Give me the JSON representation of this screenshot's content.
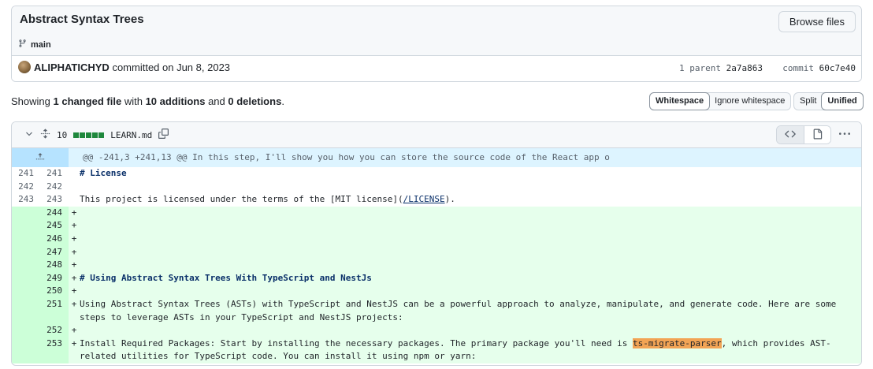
{
  "commit": {
    "title": "Abstract Syntax Trees",
    "browse_label": "Browse files",
    "branch": "main",
    "author": "ALIPHATICHYD",
    "committed_text": "committed on Jun 8, 2023",
    "parent_label": "1 parent",
    "parent_sha": "2a7a863",
    "commit_label": "commit",
    "commit_sha": "60c7e40"
  },
  "summary": {
    "prefix": "Showing",
    "changed": "1 changed file",
    "with": "with",
    "additions": "10 additions",
    "and": "and",
    "deletions": "0 deletions",
    "suffix": "."
  },
  "toolbar": {
    "whitespace": "Whitespace",
    "ignore_whitespace": "Ignore whitespace",
    "split": "Split",
    "unified": "Unified"
  },
  "file": {
    "change_count": "10",
    "name": "LEARN.md"
  },
  "diff": {
    "hunk_header": "@@ -241,3 +241,13 @@ In this step, I'll show you how you can store the source code of the React app o",
    "lines": [
      {
        "old": "241",
        "new": "241",
        "sign": "",
        "text": "# License"
      },
      {
        "old": "242",
        "new": "242",
        "sign": "",
        "text": ""
      },
      {
        "old": "243",
        "new": "243",
        "sign": "",
        "text_before": "This project is licensed under the terms of the [MIT license](",
        "link": "/LICENSE",
        "text_after": ")."
      },
      {
        "old": "",
        "new": "244",
        "sign": "+",
        "text": ""
      },
      {
        "old": "",
        "new": "245",
        "sign": "+",
        "text": ""
      },
      {
        "old": "",
        "new": "246",
        "sign": "+",
        "text": ""
      },
      {
        "old": "",
        "new": "247",
        "sign": "+",
        "text": ""
      },
      {
        "old": "",
        "new": "248",
        "sign": "+",
        "text": ""
      },
      {
        "old": "",
        "new": "249",
        "sign": "+",
        "text": "# Using Abstract Syntax Trees With TypeScript and NestJs"
      },
      {
        "old": "",
        "new": "250",
        "sign": "+",
        "text": ""
      },
      {
        "old": "",
        "new": "251",
        "sign": "+",
        "text": "Using Abstract Syntax Trees (ASTs) with TypeScript and NestJS can be a powerful approach to analyze, manipulate, and generate code. Here are some steps to leverage ASTs in your TypeScript and NestJS projects:"
      },
      {
        "old": "",
        "new": "252",
        "sign": "+",
        "text": ""
      },
      {
        "old": "",
        "new": "253",
        "sign": "+",
        "text_before": "Install Required Packages: Start by installing the necessary packages. The primary package you'll need is ",
        "highlight": "ts-migrate-parser",
        "text_after": ", which provides AST-related utilities for TypeScript code. You can install it using npm or yarn:"
      }
    ]
  }
}
